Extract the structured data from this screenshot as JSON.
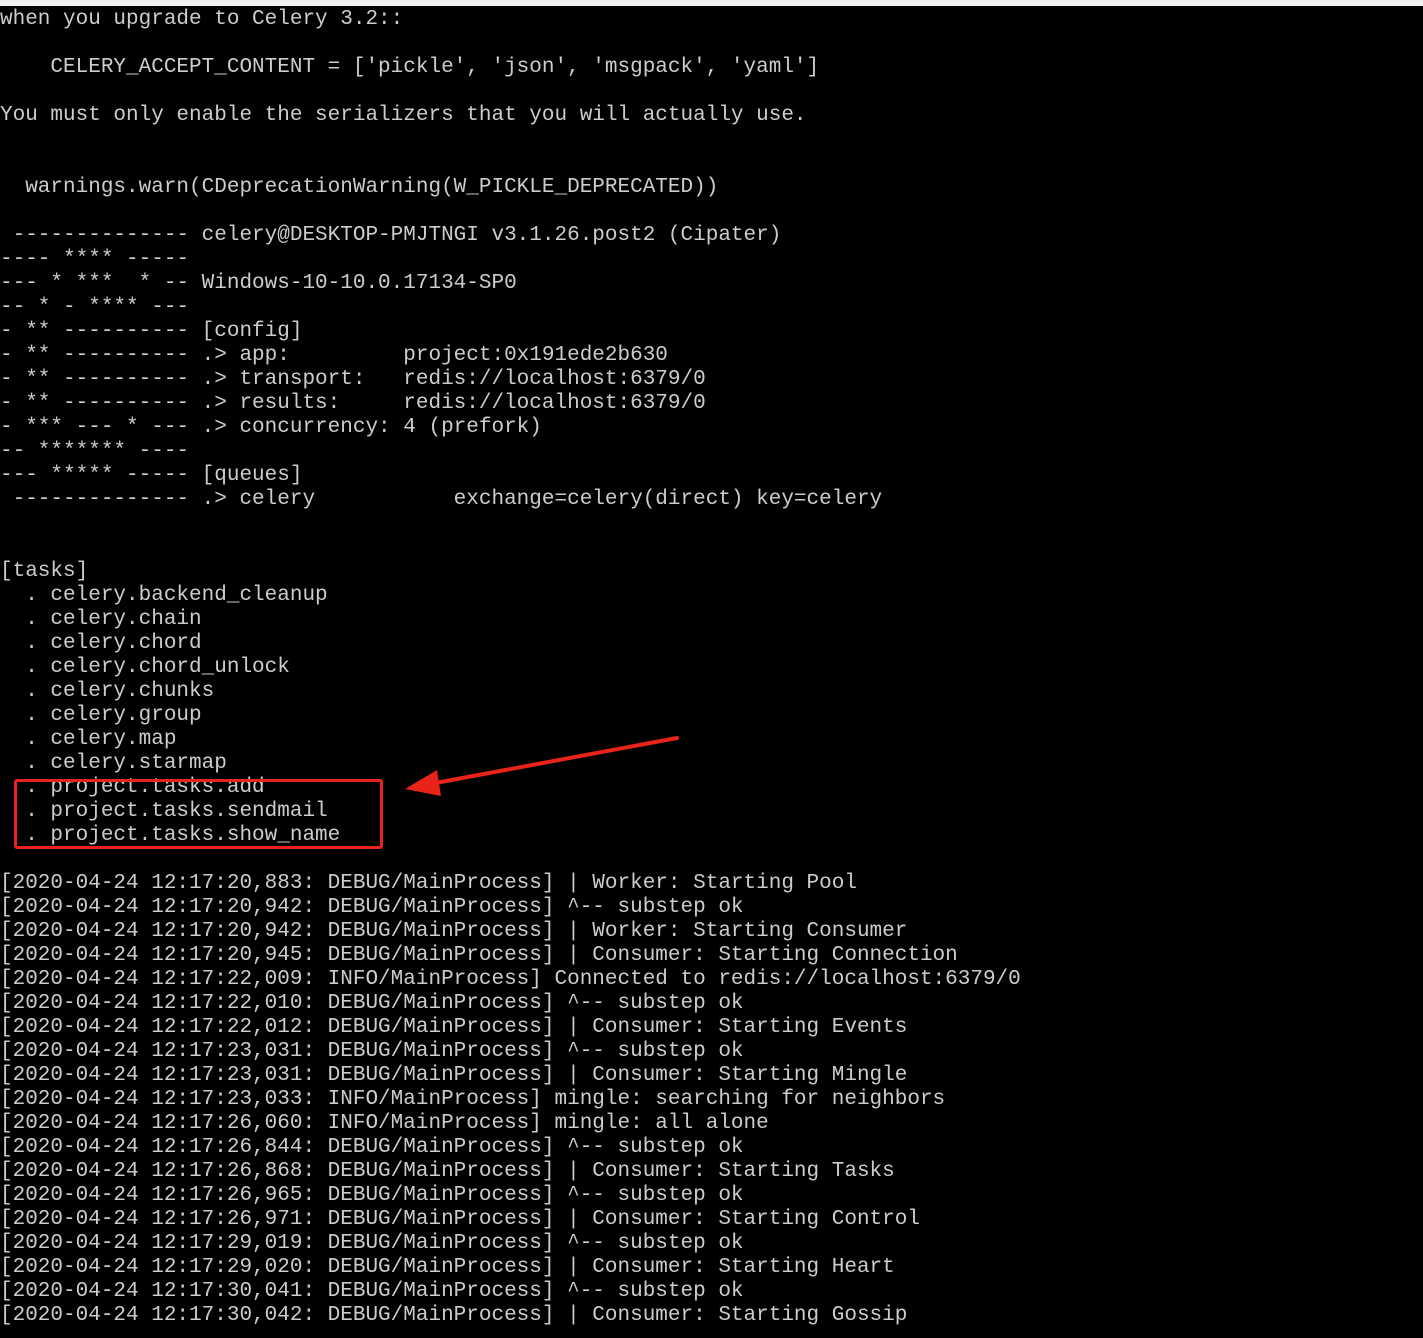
{
  "terminal": {
    "text_color": "#cccccc",
    "background_color": "#000000",
    "annotation_color": "#e8231a",
    "lines": [
      "when you upgrade to Celery 3.2::",
      "",
      "    CELERY_ACCEPT_CONTENT = ['pickle', 'json', 'msgpack', 'yaml']",
      "",
      "You must only enable the serializers that you will actually use.",
      "",
      "",
      "  warnings.warn(CDeprecationWarning(W_PICKLE_DEPRECATED))",
      "",
      " -------------- celery@DESKTOP-PMJTNGI v3.1.26.post2 (Cipater)",
      "---- **** -----",
      "--- * ***  * -- Windows-10-10.0.17134-SP0",
      "-- * - **** ---",
      "- ** ---------- [config]",
      "- ** ---------- .> app:         project:0x191ede2b630",
      "- ** ---------- .> transport:   redis://localhost:6379/0",
      "- ** ---------- .> results:     redis://localhost:6379/0",
      "- *** --- * --- .> concurrency: 4 (prefork)",
      "-- ******* ----",
      "--- ***** ----- [queues]",
      " -------------- .> celery           exchange=celery(direct) key=celery",
      "",
      "",
      "[tasks]",
      "  . celery.backend_cleanup",
      "  . celery.chain",
      "  . celery.chord",
      "  . celery.chord_unlock",
      "  . celery.chunks",
      "  . celery.group",
      "  . celery.map",
      "  . celery.starmap",
      "  . project.tasks.add",
      "  . project.tasks.sendmail",
      "  . project.tasks.show_name",
      "",
      "[2020-04-24 12:17:20,883: DEBUG/MainProcess] | Worker: Starting Pool",
      "[2020-04-24 12:17:20,942: DEBUG/MainProcess] ^-- substep ok",
      "[2020-04-24 12:17:20,942: DEBUG/MainProcess] | Worker: Starting Consumer",
      "[2020-04-24 12:17:20,945: DEBUG/MainProcess] | Consumer: Starting Connection",
      "[2020-04-24 12:17:22,009: INFO/MainProcess] Connected to redis://localhost:6379/0",
      "[2020-04-24 12:17:22,010: DEBUG/MainProcess] ^-- substep ok",
      "[2020-04-24 12:17:22,012: DEBUG/MainProcess] | Consumer: Starting Events",
      "[2020-04-24 12:17:23,031: DEBUG/MainProcess] ^-- substep ok",
      "[2020-04-24 12:17:23,031: DEBUG/MainProcess] | Consumer: Starting Mingle",
      "[2020-04-24 12:17:23,033: INFO/MainProcess] mingle: searching for neighbors",
      "[2020-04-24 12:17:26,060: INFO/MainProcess] mingle: all alone",
      "[2020-04-24 12:17:26,844: DEBUG/MainProcess] ^-- substep ok",
      "[2020-04-24 12:17:26,868: DEBUG/MainProcess] | Consumer: Starting Tasks",
      "[2020-04-24 12:17:26,965: DEBUG/MainProcess] ^-- substep ok",
      "[2020-04-24 12:17:26,971: DEBUG/MainProcess] | Consumer: Starting Control",
      "[2020-04-24 12:17:29,019: DEBUG/MainProcess] ^-- substep ok",
      "[2020-04-24 12:17:29,020: DEBUG/MainProcess] | Consumer: Starting Heart",
      "[2020-04-24 12:17:30,041: DEBUG/MainProcess] ^-- substep ok",
      "[2020-04-24 12:17:30,042: DEBUG/MainProcess] | Consumer: Starting Gossip"
    ]
  }
}
